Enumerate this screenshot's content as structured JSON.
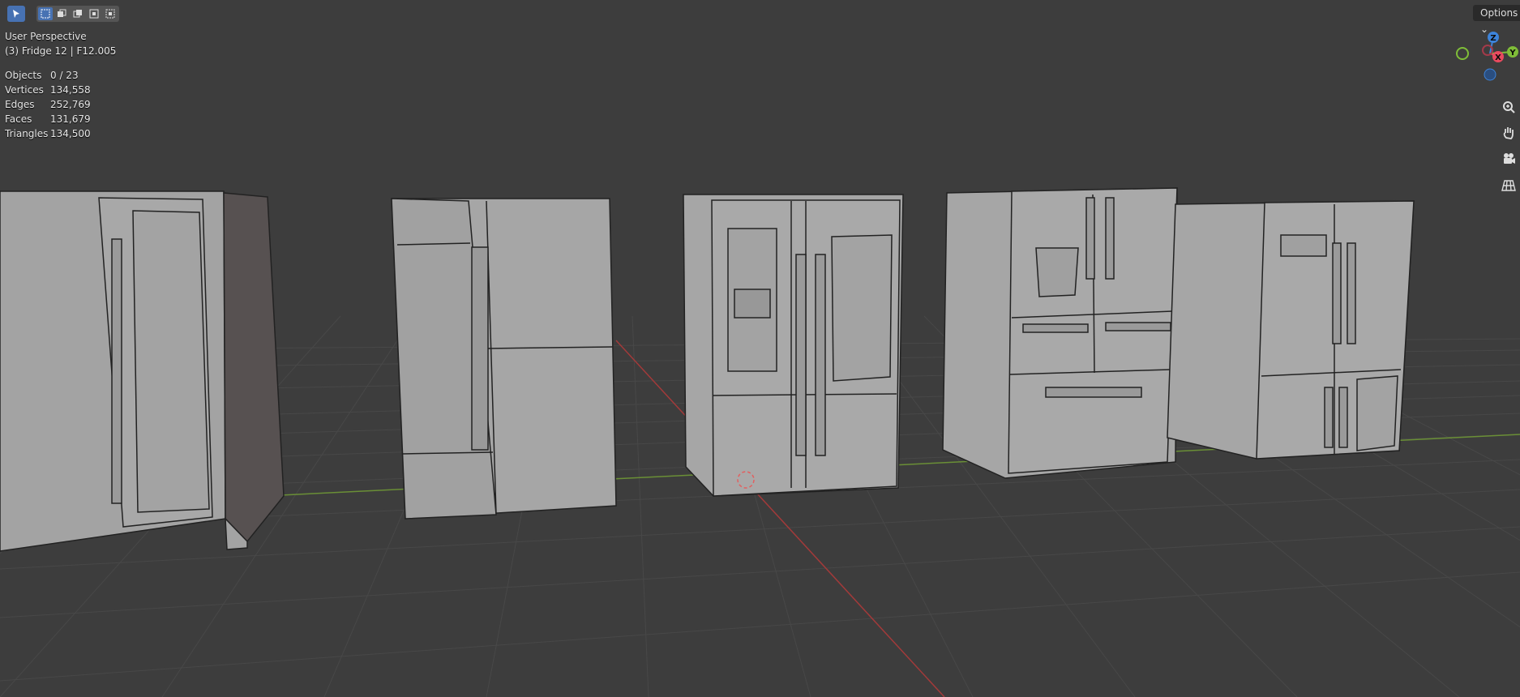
{
  "viewport": {
    "view_name": "User Perspective",
    "active_object": "(3) Fridge 12 | F12.005",
    "stats": [
      {
        "label": "Objects",
        "value": "0 / 23"
      },
      {
        "label": "Vertices",
        "value": "134,558"
      },
      {
        "label": "Edges",
        "value": "252,769"
      },
      {
        "label": "Faces",
        "value": "131,679"
      },
      {
        "label": "Triangles",
        "value": "134,500"
      }
    ]
  },
  "header": {
    "options_label": "Options",
    "options_icon": "chevron-down-icon",
    "select_tool_icon": "cursor-select-icon",
    "select_modes": [
      "select-new-icon",
      "select-extend-icon",
      "select-subtract-icon",
      "select-invert-icon",
      "select-intersect-icon"
    ]
  },
  "gizmo": {
    "z_label": "Z",
    "y_label": "Y",
    "x_label": "X",
    "colors": {
      "x": "#e84a5f",
      "y": "#7fbd38",
      "z": "#3d83d9"
    }
  },
  "nav_icons": [
    "zoom-icon",
    "pan-hand-icon",
    "camera-icon",
    "grid-view-icon"
  ],
  "colors": {
    "background": "#3d3d3d",
    "grid": "#4b4b4b",
    "x_axis": "#a33a3a",
    "y_axis": "#6a8f36",
    "model": "#a3a3a3"
  }
}
